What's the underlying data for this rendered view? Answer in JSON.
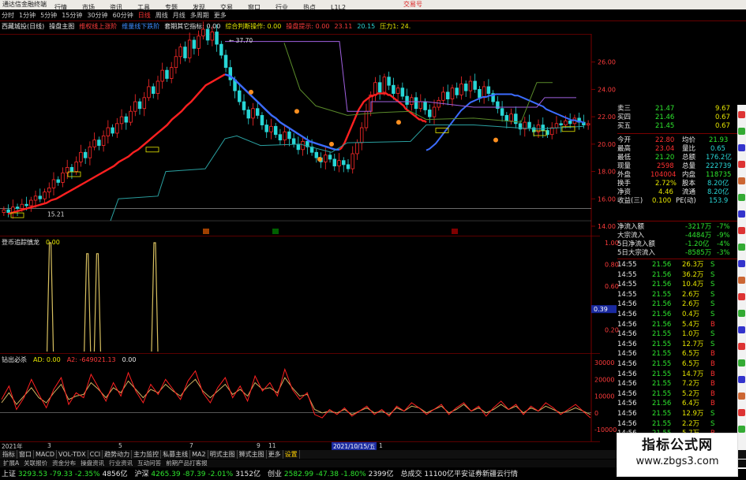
{
  "window": {
    "title": "通达信金融终端",
    "menus": [
      "行情",
      "市场",
      "资讯",
      "工具",
      "专题",
      "发现",
      "交易",
      "窗口",
      "行业",
      "热点",
      "L1L2"
    ],
    "trade_label": "交易号"
  },
  "periods": [
    "分时",
    "1分钟",
    "5分钟",
    "15分钟",
    "30分钟",
    "60分钟",
    "日线",
    "周线",
    "月线",
    "多周期",
    "更多"
  ],
  "active_period": "日线",
  "main_legend": [
    {
      "text": "西藏城投(日线)",
      "color": "#e6e6e6"
    },
    {
      "text": "操盘主图",
      "color": "#e6e6e6"
    },
    {
      "text": "维权线上涨阶",
      "color": "#ff3b3b"
    },
    {
      "text": "维量线下跌阶",
      "color": "#3c8cff"
    },
    {
      "text": "套期其它指标: 0.00",
      "color": "#e6e6e6"
    },
    {
      "text": "综合判断操作: 0.00",
      "color": "#e6e600"
    },
    {
      "text": "操盘提示: 0.00",
      "color": "#ff3b3b"
    },
    {
      "text": "23.11",
      "color": "#ff3b3b"
    },
    {
      "text": "20.15",
      "color": "#28d6d6"
    },
    {
      "text": "压力1: 24.",
      "color": "#e6e600"
    }
  ],
  "ind1_legend": [
    {
      "text": "登币追踪慎龙",
      "color": "#e6e6e6"
    },
    {
      "text": "0.00",
      "color": "#e6e600"
    }
  ],
  "ind2_legend": [
    {
      "text": "钻出必杀",
      "color": "#e6e6e6"
    },
    {
      "text": "AD: 0.00",
      "color": "#e6e600"
    },
    {
      "text": "A2: -649021.13",
      "color": "#ff3b3b"
    },
    {
      "text": "0.00",
      "color": "#e6e6e6"
    }
  ],
  "chart_data": [
    {
      "type": "candlestick",
      "name": "price",
      "ylim": [
        14,
        28
      ],
      "yticks": [
        26.0,
        24.0,
        22.0,
        20.0,
        18.0,
        16.0,
        14.0
      ],
      "close": [
        15.2,
        15.0,
        15.4,
        15.3,
        15.6,
        15.5,
        15.9,
        16.2,
        16.0,
        16.5,
        16.8,
        17.4,
        17.2,
        17.9,
        18.3,
        18.0,
        18.7,
        19.4,
        19.0,
        19.8,
        20.3,
        19.9,
        20.6,
        21.2,
        20.8,
        21.5,
        22.0,
        21.6,
        22.4,
        23.1,
        22.6,
        23.4,
        24.2,
        23.7,
        24.6,
        25.4,
        24.8,
        25.6,
        26.4,
        27.1,
        26.3,
        27.6,
        27.0,
        27.9,
        28.4,
        27.6,
        28.2,
        27.3,
        26.5,
        25.6,
        24.7,
        23.9,
        23.1,
        22.5,
        21.9,
        22.6,
        22.1,
        21.4,
        20.9,
        21.3,
        20.7,
        20.3,
        20.9,
        20.4,
        20.0,
        19.6,
        20.2,
        19.8,
        19.4,
        19.0,
        18.7,
        19.2,
        18.9,
        18.4,
        18.8,
        18.5,
        18.2,
        19.3,
        20.1,
        21.2,
        22.4,
        23.6,
        24.5,
        23.8,
        24.9,
        24.3,
        23.7,
        24.1,
        23.5,
        22.9,
        23.4,
        22.6,
        23.1,
        22.5,
        22.0,
        22.7,
        23.2,
        23.8,
        23.3,
        24.1,
        23.6,
        24.4,
        23.9,
        24.6,
        24.0,
        23.4,
        24.2,
        23.7,
        23.1,
        22.6,
        22.1,
        21.7,
        22.2,
        21.5,
        21.1,
        21.6,
        21.2,
        20.9,
        21.4,
        21.0,
        20.7,
        21.2,
        21.5,
        21.4,
        21.7,
        21.5,
        21.9,
        21.6,
        21.4,
        21.5
      ],
      "ma_red": [
        14.9,
        15.0,
        15.1,
        15.2,
        15.3,
        15.4,
        15.5,
        15.6,
        15.7,
        15.9,
        16.0,
        16.2,
        16.4,
        16.6,
        16.8,
        17.0,
        17.2,
        17.4,
        17.6,
        17.8,
        18.0,
        18.2,
        18.4,
        18.7,
        18.9,
        19.1,
        19.4,
        19.6,
        19.9,
        20.2,
        20.5,
        20.8,
        21.1,
        21.4,
        21.8,
        22.1,
        22.4,
        22.8,
        23.1,
        23.5,
        23.9,
        24.3,
        24.5,
        24.7,
        24.9,
        25.1
      ],
      "ma_blue": [
        25.1,
        25.0,
        24.8,
        24.5,
        24.2,
        23.9,
        23.6,
        23.3,
        23.0,
        22.7,
        22.4,
        22.1,
        21.9,
        21.6,
        21.4,
        21.2,
        21.0,
        20.8,
        20.6,
        20.4,
        20.2,
        20.1,
        20.0,
        19.9,
        19.8,
        19.7,
        19.6,
        19.6
      ],
      "ma_red2": [
        19.6,
        19.7,
        19.9,
        20.1,
        20.4,
        20.7,
        21.0,
        21.3,
        21.6,
        21.9,
        22.2,
        22.5,
        22.7,
        22.9,
        23.1,
        23.2,
        23.3,
        23.4,
        23.5,
        23.5,
        23.6,
        23.6,
        23.7,
        23.7,
        23.7,
        23.7,
        23.7,
        23.7,
        23.6,
        23.6,
        23.5,
        23.4,
        23.3,
        23.2,
        23.1,
        23.0,
        22.9,
        22.8,
        22.6,
        22.5,
        22.4,
        22.3,
        22.2,
        22.1,
        22.0,
        21.9,
        21.8,
        21.8,
        21.7,
        21.7,
        21.6
      ],
      "annotations": [
        {
          "text": "37.70"
        },
        {
          "text": "15.21"
        }
      ]
    },
    {
      "type": "line",
      "name": "登币追踪慎龙",
      "ylim": [
        0,
        1
      ],
      "yticks": [
        1.0,
        0.8,
        0.6,
        0.39,
        0.2
      ],
      "marker_value": 0.39,
      "spikes": [
        {
          "pos": 0.085,
          "h": 1.0
        },
        {
          "pos": 0.148,
          "h": 0.9
        },
        {
          "pos": 0.165,
          "h": 0.9
        },
        {
          "pos": 0.262,
          "h": 1.0
        }
      ]
    },
    {
      "type": "line",
      "name": "钻出必杀",
      "ylim": [
        -10000,
        30000
      ],
      "yticks": [
        30000,
        20000,
        10000,
        0,
        -10000
      ],
      "s1": [
        8000,
        16000,
        2000,
        9000,
        20000,
        11000,
        3000,
        14000,
        21000,
        5000,
        12000,
        9000,
        23000,
        15000,
        7000,
        18000,
        10000,
        24000,
        13000,
        6000,
        17000,
        11000,
        20000,
        14000,
        8000,
        19000,
        25000,
        12000,
        6000,
        15000,
        21000,
        9000,
        16000,
        7000,
        22000,
        13000,
        18000,
        10000,
        26000,
        14000,
        8000,
        12000,
        -1000,
        -3000,
        2000,
        -1000,
        3000,
        -2000,
        1000,
        4000,
        -1000,
        2000,
        -2000,
        4000,
        1000,
        6000,
        3000,
        -1000,
        2000,
        5000,
        -1000,
        3000,
        6000,
        1000,
        4000,
        -2000,
        3000,
        7000,
        2000,
        5000,
        -1000,
        4000,
        1000,
        6000,
        3000,
        -1000,
        2000,
        5000,
        1000,
        -3000
      ],
      "s2": [
        6000,
        12000,
        5000,
        10000,
        15000,
        9000,
        6000,
        12000,
        17000,
        8000,
        10000,
        11000,
        18000,
        14000,
        9000,
        15000,
        12000,
        19000,
        14000,
        9000,
        14000,
        12000,
        17000,
        13000,
        10000,
        16000,
        20000,
        13000,
        9000,
        13000,
        17000,
        11000,
        14000,
        10000,
        18000,
        14000,
        15000,
        12000,
        21000,
        15000,
        10000,
        11000,
        2000,
        0,
        1000,
        0,
        2000,
        -1000,
        1000,
        3000,
        0,
        1000,
        -1000,
        3000,
        1000,
        4000,
        3000,
        0,
        2000,
        4000,
        0,
        2000,
        5000,
        1000,
        3000,
        0,
        2000,
        5000,
        2000,
        4000,
        0,
        3000,
        1000,
        4000,
        2000,
        0,
        1000,
        3000,
        1000,
        -1000
      ]
    }
  ],
  "x_axis": {
    "labels": [
      "2021年",
      "3",
      "5",
      "7",
      "9",
      "11",
      "2021/10/15/五",
      "1"
    ],
    "highlight": "2021/10/15/五"
  },
  "sidepanel": {
    "rows": [
      [
        {
          "t": "卖三",
          "c": "c-white"
        },
        {
          "t": "21.47",
          "c": "c-green",
          "x": 48
        },
        {
          "t": "9.67",
          "c": "c-yellow",
          "x": 124
        }
      ],
      [
        {
          "t": "买四",
          "c": "c-white"
        },
        {
          "t": "21.46",
          "c": "c-green",
          "x": 48
        },
        {
          "t": "0.67",
          "c": "c-yellow",
          "x": 124
        }
      ],
      [
        {
          "t": "买五",
          "c": "c-white"
        },
        {
          "t": "21.45",
          "c": "c-green",
          "x": 48
        },
        {
          "t": "0.67",
          "c": "c-yellow",
          "x": 124
        }
      ],
      [
        {
          "t": "今开",
          "c": "c-white"
        },
        {
          "t": "22.80",
          "c": "c-red",
          "x": 48
        },
        {
          "t": "均价",
          "c": "c-white",
          "x": 82
        },
        {
          "t": "21.93",
          "c": "c-green",
          "x": 116
        }
      ],
      [
        {
          "t": "最高",
          "c": "c-white"
        },
        {
          "t": "23.04",
          "c": "c-red",
          "x": 48
        },
        {
          "t": "量比",
          "c": "c-white",
          "x": 82
        },
        {
          "t": "0.65",
          "c": "c-cyan",
          "x": 118
        }
      ],
      [
        {
          "t": "最低",
          "c": "c-white"
        },
        {
          "t": "21.20",
          "c": "c-green",
          "x": 48
        },
        {
          "t": "总额",
          "c": "c-white",
          "x": 82
        },
        {
          "t": "176.2亿",
          "c": "c-cyan",
          "x": 112
        }
      ],
      [
        {
          "t": "现量",
          "c": "c-white"
        },
        {
          "t": "2598",
          "c": "c-red",
          "x": 50
        },
        {
          "t": "总量",
          "c": "c-white",
          "x": 82
        },
        {
          "t": "222739",
          "c": "c-cyan",
          "x": 112
        }
      ],
      [
        {
          "t": "外盘",
          "c": "c-white"
        },
        {
          "t": "104004",
          "c": "c-red",
          "x": 42
        },
        {
          "t": "内盘",
          "c": "c-white",
          "x": 82
        },
        {
          "t": "118735",
          "c": "c-green",
          "x": 112
        }
      ],
      [
        {
          "t": "换手",
          "c": "c-white"
        },
        {
          "t": "2.72%",
          "c": "c-yellow",
          "x": 48
        },
        {
          "t": "股本",
          "c": "c-white",
          "x": 82
        },
        {
          "t": "8.20亿",
          "c": "c-cyan",
          "x": 114
        }
      ],
      [
        {
          "t": "净资",
          "c": "c-white"
        },
        {
          "t": "4.46",
          "c": "c-yellow",
          "x": 52
        },
        {
          "t": "流通",
          "c": "c-white",
          "x": 82
        },
        {
          "t": "8.20亿",
          "c": "c-cyan",
          "x": 114
        }
      ],
      [
        {
          "t": "收益(三)",
          "c": "c-white"
        },
        {
          "t": "0.100",
          "c": "c-yellow",
          "x": 44
        },
        {
          "t": "PE(动)",
          "c": "c-white",
          "x": 74
        },
        {
          "t": "153.9",
          "c": "c-cyan",
          "x": 116
        }
      ],
      [
        {
          "t": "净流入额",
          "c": "c-white"
        },
        {
          "t": "-3217万",
          "c": "c-green",
          "x": 86
        },
        {
          "t": "-7%",
          "c": "c-green",
          "x": 126
        }
      ],
      [
        {
          "t": "大宗流入",
          "c": "c-white"
        },
        {
          "t": "-4484万",
          "c": "c-green",
          "x": 86
        },
        {
          "t": "-9%",
          "c": "c-green",
          "x": 126
        }
      ],
      [
        {
          "t": "5日净流入额",
          "c": "c-white"
        },
        {
          "t": "-1.20亿",
          "c": "c-green",
          "x": 86
        },
        {
          "t": "-4%",
          "c": "c-green",
          "x": 126
        }
      ],
      [
        {
          "t": "5日大宗流入",
          "c": "c-white"
        },
        {
          "t": "-8585万",
          "c": "c-green",
          "x": 86
        },
        {
          "t": "-3%",
          "c": "c-green",
          "x": 126
        }
      ]
    ],
    "ticks": [
      [
        "14:55",
        "21.56",
        "26.3万",
        "S"
      ],
      [
        "14:55",
        "21.56",
        "36.2万",
        "S"
      ],
      [
        "14:55",
        "21.56",
        "10.4万",
        "S"
      ],
      [
        "14:55",
        "21.55",
        "2.6万",
        "S"
      ],
      [
        "14:56",
        "21.56",
        "2.6万",
        "S"
      ],
      [
        "14:56",
        "21.56",
        "0.4万",
        "S"
      ],
      [
        "14:56",
        "21.56",
        "5.4万",
        "B"
      ],
      [
        "14:56",
        "21.55",
        "1.0万",
        "S"
      ],
      [
        "14:56",
        "21.55",
        "12.7万",
        "S"
      ],
      [
        "14:56",
        "21.55",
        "6.5万",
        "B"
      ],
      [
        "14:56",
        "21.55",
        "6.5万",
        "B"
      ],
      [
        "14:56",
        "21.55",
        "14.7万",
        "B"
      ],
      [
        "14:56",
        "21.55",
        "7.2万",
        "B"
      ],
      [
        "14:56",
        "21.55",
        "5.2万",
        "B"
      ],
      [
        "14:56",
        "21.56",
        "6.4万",
        "B"
      ],
      [
        "14:56",
        "21.55",
        "12.9万",
        "S"
      ],
      [
        "14:56",
        "21.55",
        "2.2万",
        "S"
      ],
      [
        "14:56",
        "21.55",
        "5.7万",
        "B"
      ]
    ]
  },
  "tabs": [
    "指标",
    "窗口",
    "MACD",
    "VOL-TDX",
    "CCI",
    "趋势动力",
    "主力监控",
    "私募主线",
    "MA2",
    "明式主图",
    "狮式主图",
    "更多",
    "设置"
  ],
  "active_tab": "设置",
  "subtabs": [
    "扩展A",
    "关联报价",
    "资金分布",
    "操盘资讯",
    "行业资讯",
    "互动问答",
    "前期产品打客报"
  ],
  "indices": [
    {
      "name": "上证",
      "v": "3293.53",
      "ch": "-79.33",
      "pct": "-2.35%",
      "amt": "4856亿"
    },
    {
      "name": "沪深",
      "v": "4265.39",
      "ch": "-87.39",
      "pct": "-2.01%",
      "amt": "3152亿"
    },
    {
      "name": "创业",
      "v": "2582.99",
      "ch": "-47.38",
      "pct": "-1.80%",
      "amt": "2399亿"
    }
  ],
  "footer_extra": "总成交 11100亿平安证券新疆云行情",
  "watermark": {
    "line1": "指标公式网",
    "line2": "www.zbgs3.com"
  }
}
